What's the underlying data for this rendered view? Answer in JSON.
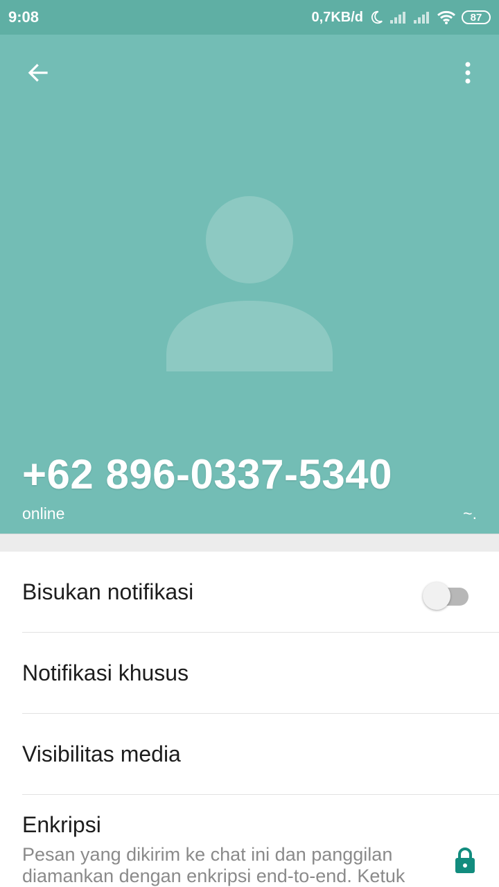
{
  "status_bar": {
    "time": "9:08",
    "speed": "0,7KB/d",
    "battery": "87",
    "icons": [
      "moon-icon",
      "signal-icon",
      "signal-icon",
      "wifi-icon",
      "battery-icon"
    ]
  },
  "header": {
    "back_icon": "arrow-left-icon",
    "menu_icon": "more-vertical-icon",
    "phone": "+62 896-0337-5340",
    "status": "online",
    "push_name": "~."
  },
  "settings": {
    "mute_label": "Bisukan notifikasi",
    "mute_enabled": false,
    "custom_notifications_label": "Notifikasi khusus",
    "media_visibility_label": "Visibilitas media",
    "encryption_title": "Enkripsi",
    "encryption_desc": "Pesan yang dikirim ke chat ini dan panggilan diamankan dengan enkripsi end-to-end. Ketuk"
  },
  "colors": {
    "header_bg": "#73bdb5",
    "status_bar_bg": "#5fafa4",
    "accent": "#128c7e"
  }
}
